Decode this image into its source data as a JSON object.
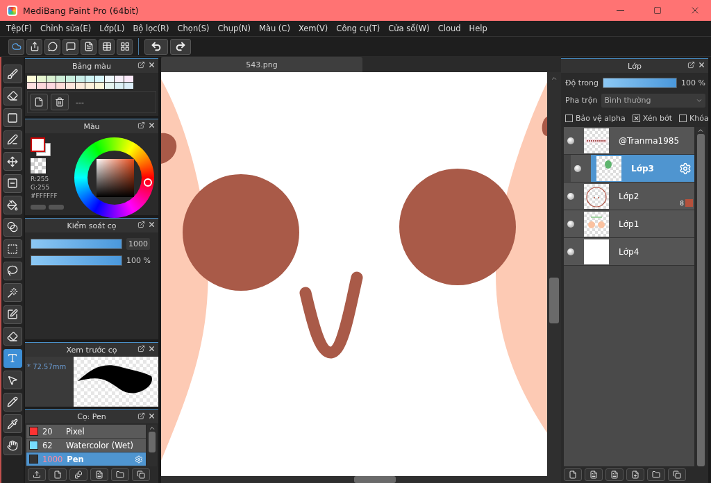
{
  "window": {
    "title": "MediBang Paint Pro (64bit)"
  },
  "menu": [
    "Tệp(F)",
    "Chỉnh sửa(E)",
    "Lớp(L)",
    "Bộ lọc(R)",
    "Chọn(S)",
    "Chụp(N)",
    "Màu (C)",
    "Xem(V)",
    "Công cụ(T)",
    "Cửa sổ(W)",
    "Cloud",
    "Help"
  ],
  "tools": [
    {
      "selected": false
    },
    {
      "selected": false
    },
    {
      "selected": false
    },
    {
      "selected": false
    },
    {
      "selected": false
    },
    {
      "selected": false
    },
    {
      "selected": false
    },
    {
      "selected": false
    },
    {
      "selected": false
    },
    {
      "selected": false
    },
    {
      "selected": false
    },
    {
      "selected": false
    },
    {
      "selected": false
    },
    {
      "selected": true
    },
    {
      "selected": false
    },
    {
      "selected": false
    },
    {
      "selected": false
    },
    {
      "selected": false
    }
  ],
  "palette": {
    "title": "Bảng màu",
    "name": "---",
    "swatches": [
      {
        "color": "#fefbd8"
      },
      {
        "color": "#e6f5d0"
      },
      {
        "color": "#d8f0d0"
      },
      {
        "color": "#cdeed7"
      },
      {
        "color": "#c8eedd"
      },
      {
        "color": "#c9eee8"
      },
      {
        "color": "#cff4f5"
      },
      {
        "color": "#d8f7fc"
      },
      {
        "color": "#eef8fc"
      },
      {
        "color": "#f8f0fa"
      },
      {
        "color": "#fae8f8"
      },
      {
        "color": "#fde0e0"
      },
      {
        "color": "#fcd8dc"
      },
      {
        "color": "#fcd8e0"
      },
      {
        "color": "#fcdcd8"
      },
      {
        "color": "#fce6dc"
      },
      {
        "color": "#fcecdc"
      },
      {
        "color": "#fdf2dc"
      },
      {
        "color": "#fbf7dc"
      },
      {
        "color": "#e5f4f0"
      },
      {
        "color": "#dcf0f5"
      },
      {
        "color": "#dceef8"
      }
    ]
  },
  "color": {
    "title": "Màu",
    "r": "R:255",
    "g": "G:255",
    "hex": "#FFFFFF"
  },
  "brush_control": {
    "title": "Kiểm soát cọ",
    "size": {
      "level": 1,
      "reading": "1000"
    },
    "opacity": {
      "level": 1,
      "reading": "100 %"
    }
  },
  "brush_preview": {
    "title": "Xem trước cọ",
    "size": "* 72.57mm"
  },
  "brushes": {
    "title": "Cọ: Pen",
    "items": [
      {
        "size": "20",
        "name": "Pixel",
        "color": "#ff3333",
        "selected": false
      },
      {
        "size": "62",
        "name": "Watercolor (Wet)",
        "color": "#77ddff",
        "selected": false
      },
      {
        "size": "1000",
        "name": "Pen",
        "color": "#333333",
        "selected": true
      }
    ]
  },
  "canvas": {
    "tab": "543.png"
  },
  "layers": {
    "title": "Lớp",
    "opacity": {
      "label": "Độ trong",
      "level": 1,
      "reading": "100 %"
    },
    "blend": {
      "label": "Pha trộn",
      "value": "Bình thường"
    },
    "options": [
      {
        "label": "Bảo vệ alpha",
        "checked": false
      },
      {
        "label": "Xén bớt",
        "checked": true
      },
      {
        "label": "Khóa",
        "checked": false
      }
    ],
    "items": [
      {
        "name": "@Tranma1985",
        "visible": true,
        "selected": false,
        "clipped": false
      },
      {
        "name": "Lớp3",
        "visible": true,
        "selected": true,
        "clipped": true
      },
      {
        "name": "Lớp2",
        "visible": true,
        "selected": false,
        "clipped": false,
        "badge": "8",
        "color": "#b5513c"
      },
      {
        "name": "Lớp1",
        "visible": true,
        "selected": false,
        "clipped": false
      },
      {
        "name": "Lớp4",
        "visible": true,
        "selected": false,
        "clipped": false
      }
    ]
  }
}
